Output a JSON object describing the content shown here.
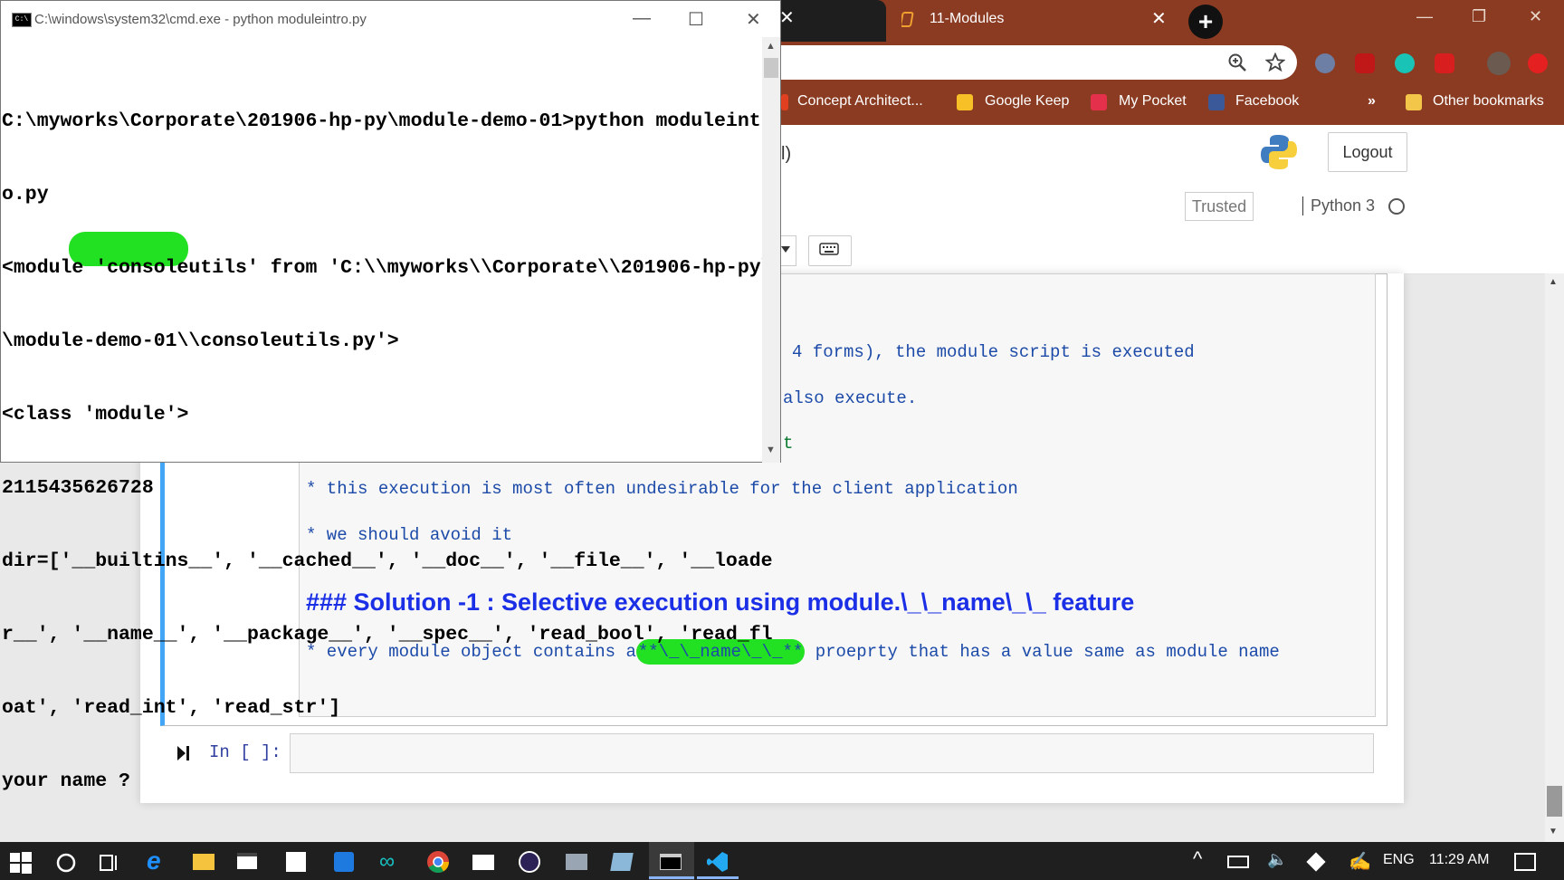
{
  "cmd": {
    "title": "C:\\windows\\system32\\cmd.exe - python  moduleintro.py",
    "icon_label": "C:\\",
    "lines": [
      "C:\\myworks\\Corporate\\201906-hp-py\\module-demo-01>python moduleintr",
      "o.py",
      "<module 'consoleutils' from 'C:\\\\myworks\\\\Corporate\\\\201906-hp-py\\",
      "\\module-demo-01\\\\consoleutils.py'>",
      "<class 'module'>",
      "2115435626728",
      "dir=['__builtins__', '__cached__', '__doc__', '__file__', '__loade",
      "r__', '__name__', '__package__', '__spec__', 'read_bool', 'read_fl",
      "oat', 'read_int', 'read_str']",
      "your name ?"
    ]
  },
  "chrome": {
    "active_tab_title": "11-Modules",
    "bookmarks": [
      {
        "label": "Concept Architect...",
        "icon": "page-icon"
      },
      {
        "label": "Google Keep",
        "icon": "keep-icon"
      },
      {
        "label": "My Pocket",
        "icon": "pocket-icon"
      },
      {
        "label": "Facebook",
        "icon": "facebook-icon"
      }
    ],
    "overflow": "»",
    "other_bookmarks": "Other bookmarks"
  },
  "jupyter": {
    "header_fragment": "l)",
    "logout": "Logout",
    "trusted": "Trusted",
    "kernel": "Python 3",
    "markdown_lines": [
      "4 forms), the module script is executed",
      "also execute.",
      "t",
      "* this execution is most often undesirable for the client application",
      "* we should avoid it"
    ],
    "heading": "### Solution -1 : Selective execution using module.\\_\\_name\\_\\_ feature",
    "bullet_prefix": "* every module object contains a",
    "bullet_highlight": "**\\_\\_name\\_\\_**",
    "bullet_suffix": " proeprty that has a value same as module name",
    "prompt": "In [ ]:"
  },
  "taskbar": {
    "lang": "ENG",
    "time": "11:29 AM"
  },
  "colors": {
    "chrome_theme": "#8a3b22",
    "highlight": "#22e022",
    "cell_border": "#42a5f5",
    "markdown_text": "#1c4aa8",
    "heading_text": "#1a2fe6"
  }
}
